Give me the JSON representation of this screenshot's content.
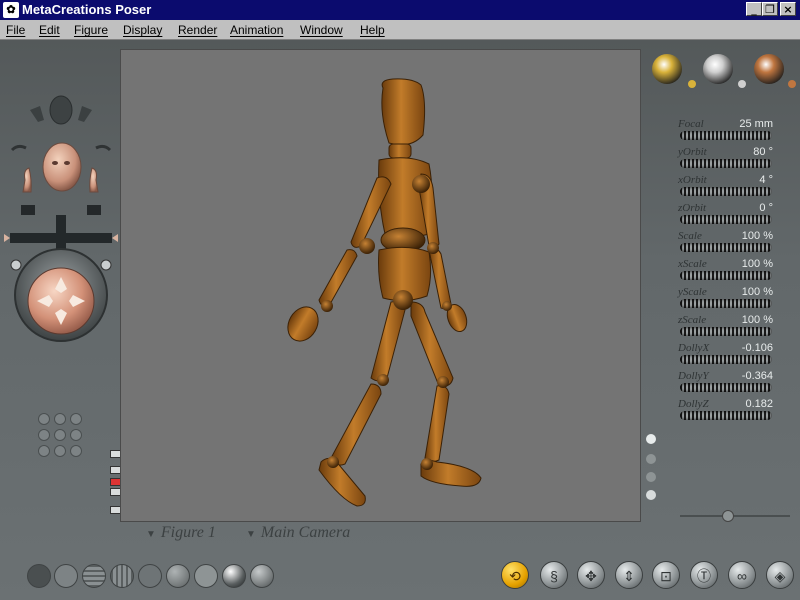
{
  "window": {
    "title": "MetaCreations Poser",
    "controls": {
      "minimize": "_",
      "restore": "❐",
      "close": "×"
    }
  },
  "menubar": {
    "items": [
      {
        "label": "File"
      },
      {
        "label": "Edit"
      },
      {
        "label": "Figure"
      },
      {
        "label": "Display"
      },
      {
        "label": "Render"
      },
      {
        "label": "Animation"
      },
      {
        "label": "Window"
      },
      {
        "label": "Help"
      }
    ]
  },
  "parameters": [
    {
      "name": "Focal",
      "value": "25 mm"
    },
    {
      "name": "yOrbit",
      "value": "80 °"
    },
    {
      "name": "xOrbit",
      "value": "4 °"
    },
    {
      "name": "zOrbit",
      "value": "0 °"
    },
    {
      "name": "Scale",
      "value": "100 %"
    },
    {
      "name": "xScale",
      "value": "100 %"
    },
    {
      "name": "yScale",
      "value": "100 %"
    },
    {
      "name": "zScale",
      "value": "100 %"
    },
    {
      "name": "DollyX",
      "value": "-0.106"
    },
    {
      "name": "DollyY",
      "value": "-0.364"
    },
    {
      "name": "DollyZ",
      "value": "0.182"
    }
  ],
  "document_menus": {
    "figure": "Figure 1",
    "camera": "Main Camera"
  },
  "lights": {
    "colors": [
      "#d9b23a",
      "#cfcfcf",
      "#c07640"
    ]
  },
  "toolbar": {
    "icons": [
      "rotate-icon",
      "twist-icon",
      "translate-icon",
      "translate-in-out-icon",
      "scale-icon",
      "taper-icon",
      "chain-break-icon",
      "color-icon"
    ],
    "active_index": 0
  },
  "accent_colors": {
    "title_bar": "#0b0b6e",
    "figure_wood": "#a8641c"
  }
}
